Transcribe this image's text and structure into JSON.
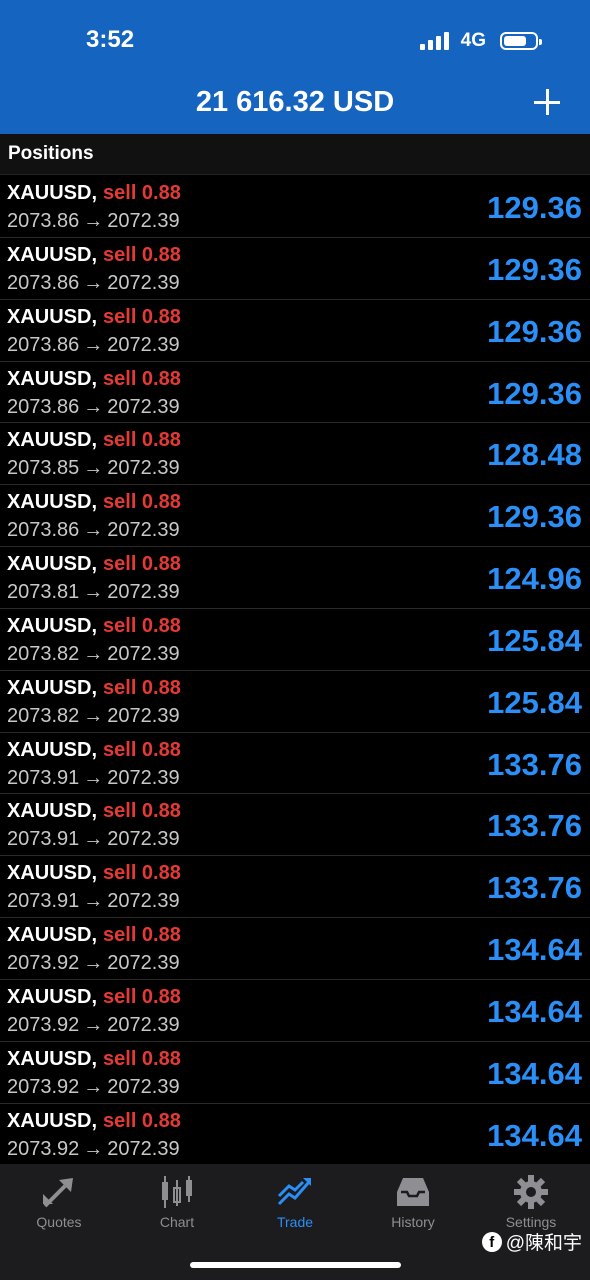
{
  "status": {
    "time": "3:52",
    "network": "4G"
  },
  "header": {
    "balance": "21 616.32 USD"
  },
  "section": {
    "title": "Positions"
  },
  "positions": [
    {
      "symbol": "XAUUSD,",
      "side": "sell 0.88",
      "open": "2073.86",
      "current": "2072.39",
      "profit": "129.36"
    },
    {
      "symbol": "XAUUSD,",
      "side": "sell 0.88",
      "open": "2073.86",
      "current": "2072.39",
      "profit": "129.36"
    },
    {
      "symbol": "XAUUSD,",
      "side": "sell 0.88",
      "open": "2073.86",
      "current": "2072.39",
      "profit": "129.36"
    },
    {
      "symbol": "XAUUSD,",
      "side": "sell 0.88",
      "open": "2073.86",
      "current": "2072.39",
      "profit": "129.36"
    },
    {
      "symbol": "XAUUSD,",
      "side": "sell 0.88",
      "open": "2073.85",
      "current": "2072.39",
      "profit": "128.48"
    },
    {
      "symbol": "XAUUSD,",
      "side": "sell 0.88",
      "open": "2073.86",
      "current": "2072.39",
      "profit": "129.36"
    },
    {
      "symbol": "XAUUSD,",
      "side": "sell 0.88",
      "open": "2073.81",
      "current": "2072.39",
      "profit": "124.96"
    },
    {
      "symbol": "XAUUSD,",
      "side": "sell 0.88",
      "open": "2073.82",
      "current": "2072.39",
      "profit": "125.84"
    },
    {
      "symbol": "XAUUSD,",
      "side": "sell 0.88",
      "open": "2073.82",
      "current": "2072.39",
      "profit": "125.84"
    },
    {
      "symbol": "XAUUSD,",
      "side": "sell 0.88",
      "open": "2073.91",
      "current": "2072.39",
      "profit": "133.76"
    },
    {
      "symbol": "XAUUSD,",
      "side": "sell 0.88",
      "open": "2073.91",
      "current": "2072.39",
      "profit": "133.76"
    },
    {
      "symbol": "XAUUSD,",
      "side": "sell 0.88",
      "open": "2073.91",
      "current": "2072.39",
      "profit": "133.76"
    },
    {
      "symbol": "XAUUSD,",
      "side": "sell 0.88",
      "open": "2073.92",
      "current": "2072.39",
      "profit": "134.64"
    },
    {
      "symbol": "XAUUSD,",
      "side": "sell 0.88",
      "open": "2073.92",
      "current": "2072.39",
      "profit": "134.64"
    },
    {
      "symbol": "XAUUSD,",
      "side": "sell 0.88",
      "open": "2073.92",
      "current": "2072.39",
      "profit": "134.64"
    },
    {
      "symbol": "XAUUSD,",
      "side": "sell 0.88",
      "open": "2073.92",
      "current": "2072.39",
      "profit": "134.64"
    }
  ],
  "arrow": "→",
  "tabs": [
    {
      "label": "Quotes",
      "icon": "quotes-icon"
    },
    {
      "label": "Chart",
      "icon": "candlestick-icon"
    },
    {
      "label": "Trade",
      "icon": "trade-icon",
      "active": true
    },
    {
      "label": "History",
      "icon": "inbox-icon"
    },
    {
      "label": "Settings",
      "icon": "gear-icon"
    }
  ],
  "watermark": {
    "text": "@陳和宇"
  },
  "colors": {
    "header": "#1565c0",
    "sell": "#e53935",
    "profit": "#2a8ff7",
    "tab_active": "#2a8ff7",
    "tab_inactive": "#8e8e93"
  }
}
